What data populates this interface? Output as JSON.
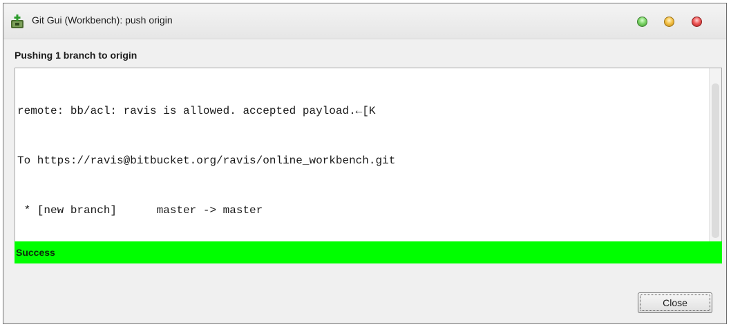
{
  "window": {
    "title": "Git Gui (Workbench): push origin",
    "icon": "git-gui-icon"
  },
  "heading": "Pushing 1 branch to origin",
  "output": {
    "lines": [
      "remote: bb/acl: ravis is allowed. accepted payload.←[K",
      "To https://ravis@bitbucket.org/ravis/online_workbench.git",
      " * [new branch]      master -> master"
    ]
  },
  "status": {
    "text": "Success",
    "color": "#00ff00"
  },
  "buttons": {
    "close_label": "Close"
  }
}
